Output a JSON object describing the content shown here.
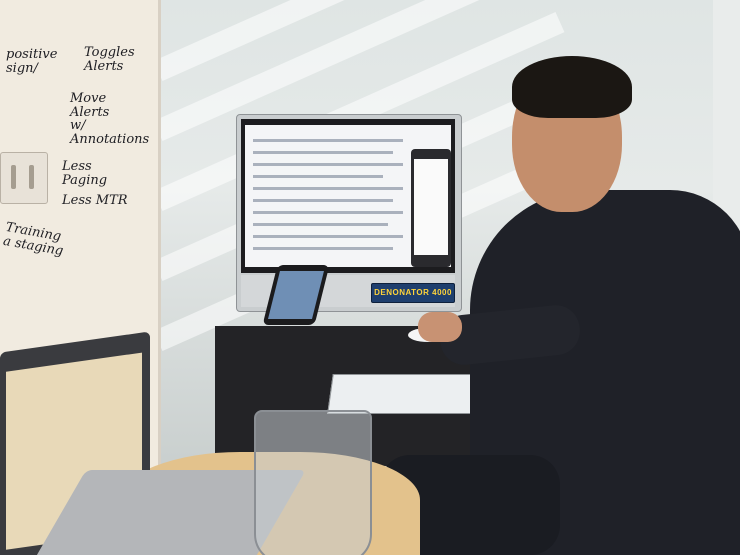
{
  "whiteboard": {
    "notes": [
      "positive\nsign/",
      "Toggles\nAlerts",
      "Move\nAlerts\nw/\nAnnotations",
      "Less\nPaging",
      "Less MTR",
      "Training\na staging"
    ]
  },
  "monitor": {
    "sticker_text": "DENONATOR 4000"
  },
  "colors": {
    "whiteboard": "#f1ebe0",
    "sticker_bg": "#1f3f6e",
    "sticker_text": "#ffd43a",
    "hoodie": "#1f2128"
  }
}
